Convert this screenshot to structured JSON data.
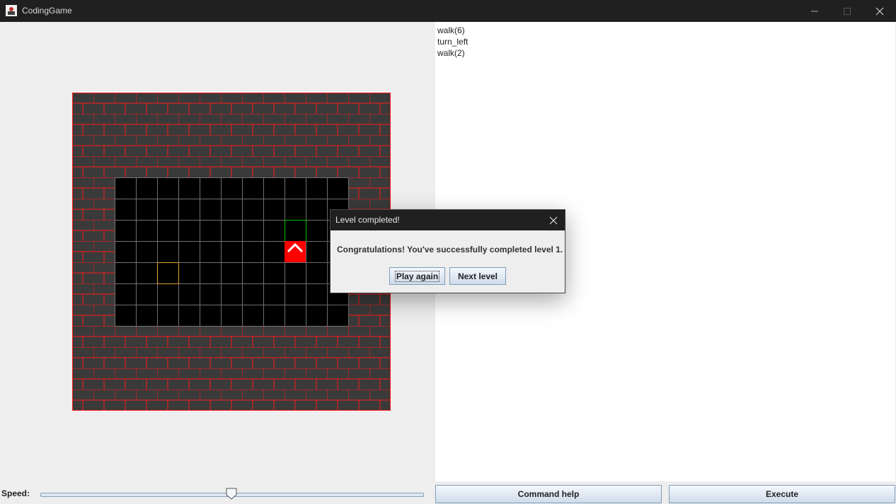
{
  "window": {
    "title": "CodingGame"
  },
  "code_lines": [
    "walk(6)",
    "turn_left",
    "walk(2)"
  ],
  "controls": {
    "speed_label": "Speed:",
    "speed_fraction": 0.5,
    "command_help_label": "Command help",
    "execute_label": "Execute"
  },
  "board": {
    "grid_cols": 11,
    "grid_rows": 7,
    "goal_cell": [
      8,
      2
    ],
    "robot_cell": [
      8,
      3
    ],
    "robot_direction": "up",
    "start_cell": [
      2,
      4
    ],
    "colors": {
      "wall": "#3a3a3a",
      "mortar": "#ff1a1a",
      "floor": "#000000",
      "grid": "#707070",
      "robot": "#ff0000",
      "goal": "#00c000",
      "start": "#e0a030"
    }
  },
  "dialog": {
    "title": "Level completed!",
    "message": "Congratulations! You've successfully completed level 1.",
    "play_again_label": "Play again",
    "next_level_label": "Next level"
  },
  "icons": {
    "app": "app-logo-icon",
    "minimize": "minimize-icon",
    "maximize": "maximize-icon",
    "close": "close-icon"
  }
}
